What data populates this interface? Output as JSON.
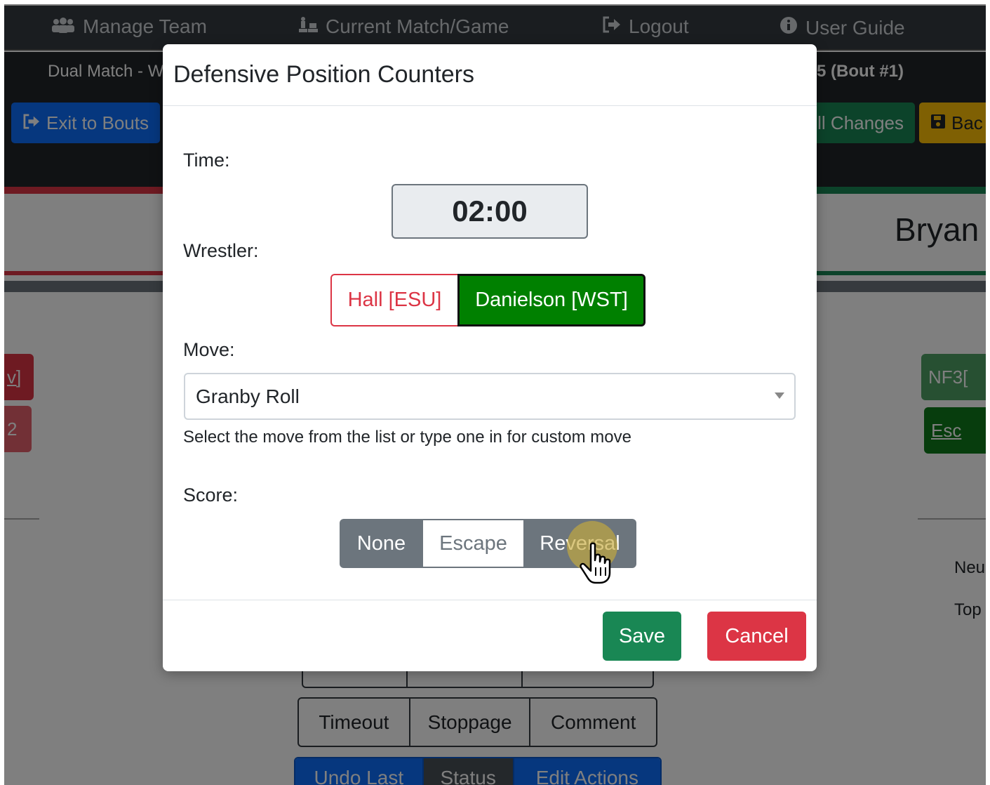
{
  "topnav": {
    "items": [
      {
        "icon": "team-icon",
        "label": "Manage Team"
      },
      {
        "icon": "chess-icon",
        "label": "Current Match/Game"
      },
      {
        "icon": "sign-out-icon",
        "label": "Logout"
      },
      {
        "icon": "info-circle-icon",
        "label": "User Guide"
      }
    ]
  },
  "subbar": {
    "left_text": "Dual Match - W",
    "right_text": "5 (Bout #1)"
  },
  "toolbar": {
    "exit_label": "Exit to Bouts",
    "changes_label": "ll Changes",
    "back_label": "Bac"
  },
  "background": {
    "wrestler_name": "Bryan",
    "left_btn1": "v]",
    "left_btn2": "2",
    "right_btn1": "NF3[",
    "right_btn2": "Esc",
    "side_text1": "Neu",
    "side_text2": "Top",
    "row2": [
      "Timeout",
      "Stoppage",
      "Comment"
    ],
    "row3": [
      "Undo Last",
      "Status",
      "Edit Actions"
    ]
  },
  "modal": {
    "title": "Defensive Position Counters",
    "time_label": "Time:",
    "time_value": "02:00",
    "wrestler_label": "Wrestler:",
    "wrestlers": [
      "Hall [ESU]",
      "Danielson [WST]"
    ],
    "selected_wrestler": "Danielson [WST]",
    "move_label": "Move:",
    "move_value": "Granby Roll",
    "move_help": "Select the move from the list or type one in for custom move",
    "score_label": "Score:",
    "score_options": [
      "None",
      "Escape",
      "Reversal"
    ],
    "selected_score": "Escape",
    "save_label": "Save",
    "cancel_label": "Cancel"
  },
  "colors": {
    "primary": "#0d6efd",
    "success": "#198754",
    "danger": "#dc3545",
    "warning": "#ffc107",
    "secondary": "#6c757d",
    "wrestler_green": "#008000"
  }
}
